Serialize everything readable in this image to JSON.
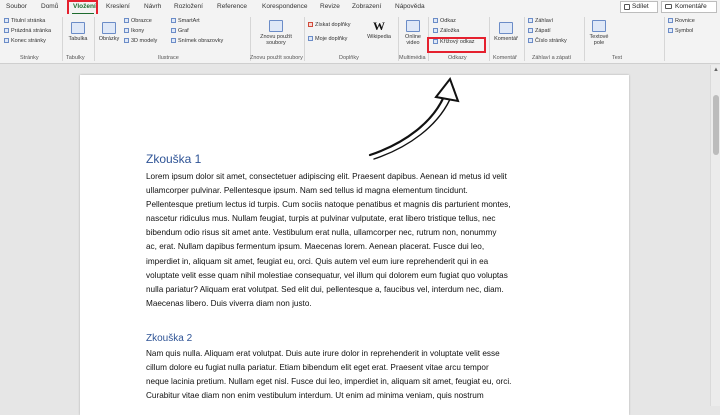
{
  "tabs": [
    "Soubor",
    "Domů",
    "Vložení",
    "Kreslení",
    "Návrh",
    "Rozložení",
    "Reference",
    "Korespondence",
    "Revize",
    "Zobrazení",
    "Nápověda"
  ],
  "active_tab": "Vložení",
  "share_label": "Sdílet",
  "comments_label": "Komentáře",
  "ribbon": {
    "pages": {
      "items": [
        "Titulní stránka",
        "Prázdná stránka",
        "Konec stránky"
      ],
      "label": "Stránky"
    },
    "tables": {
      "button": "Tabulka",
      "label": "Tabulky"
    },
    "illustrations": {
      "pictures": "Obrázky",
      "shapes": "Obrazce",
      "icons": "Ikony",
      "models": "3D modely",
      "smartart": "SmartArt",
      "chart": "Graf",
      "screenshot": "Snímek obrazovky",
      "label": "Ilustrace"
    },
    "reused": {
      "button_line1": "Znovu použít",
      "button_line2": "soubory",
      "label": "Znovu použít soubory"
    },
    "addins": {
      "get": "Získat doplňky",
      "mine": "Moje doplňky",
      "wikipedia": "Wikipedia",
      "label": "Doplňky"
    },
    "media": {
      "button_line1": "Online",
      "button_line2": "video",
      "label": "Multimédia"
    },
    "links": {
      "link": "Odkaz",
      "bookmark": "Záložka",
      "cross_ref": "Křížový odkaz",
      "label": "Odkazy"
    },
    "comments": {
      "button": "Komentář",
      "label": "Komentář"
    },
    "header_footer": {
      "header": "Záhlaví",
      "footer": "Zápatí",
      "page_number": "Číslo stránky",
      "label": "Záhlaví a zápatí"
    },
    "text": {
      "textbox_line1": "Textové",
      "textbox_line2": "pole",
      "label": "Text"
    },
    "symbols": {
      "equation": "Rovnice",
      "symbol": "Symbol"
    }
  },
  "document": {
    "heading1": "Zkouška 1",
    "para1": [
      "Lorem ipsum dolor sit amet, consectetuer adipiscing elit. Praesent dapibus. Aenean id metus id velit",
      "ullamcorper pulvinar. Pellentesque ipsum. Nam sed tellus id magna elementum tincidunt.",
      "Pellentesque pretium lectus id turpis. Cum sociis natoque penatibus et magnis dis parturient montes,",
      "nascetur ridiculus mus. Nullam feugiat, turpis at pulvinar vulputate, erat libero tristique tellus, nec",
      "bibendum odio risus sit amet ante. Vestibulum erat nulla, ullamcorper nec, rutrum non, nonummy",
      "ac, erat. Nullam dapibus fermentum ipsum. Maecenas lorem. Aenean placerat. Fusce dui leo,",
      "imperdiet in, aliquam sit amet, feugiat eu, orci. Quis autem vel eum iure reprehenderit qui in ea",
      "voluptate velit esse quam nihil molestiae consequatur, vel illum qui dolorem eum fugiat quo voluptas",
      "nulla pariatur? Aliquam erat volutpat. Sed elit dui, pellentesque a, faucibus vel, interdum nec, diam.",
      "Maecenas libero. Duis viverra diam non justo."
    ],
    "heading2": "Zkouška 2",
    "para2": [
      "Nam quis nulla. Aliquam erat volutpat. Duis aute irure dolor in reprehenderit in voluptate velit esse",
      "cillum dolore eu fugiat nulla pariatur. Etiam bibendum elit eget erat. Praesent vitae arcu tempor",
      "neque lacinia pretium. Nullam eget nisl. Fusce dui leo, imperdiet in, aliquam sit amet, feugiat eu, orci.",
      "Curabitur vitae diam non enim vestibulum interdum. Ut enim ad minima veniam, quis nostrum"
    ]
  },
  "colors": {
    "accent_green": "#1e6b2e",
    "highlight_red": "#e5202e",
    "heading_blue": "#2f5496"
  }
}
